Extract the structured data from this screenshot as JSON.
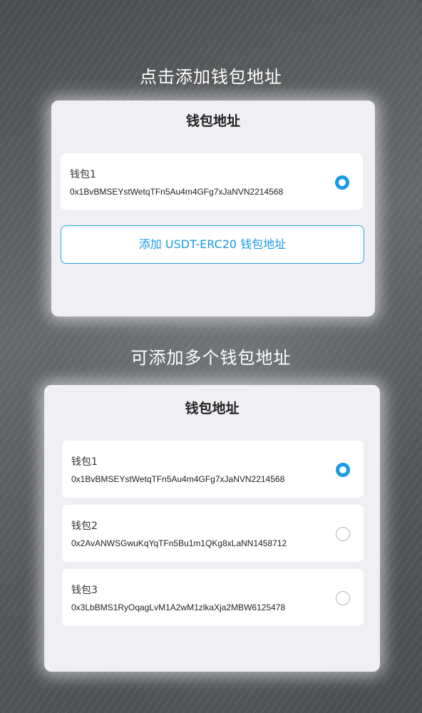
{
  "section1": {
    "heading": "点击添加钱包地址",
    "card_title": "钱包地址",
    "wallets": [
      {
        "name": "钱包1",
        "address": "0x1BvBMSEYstWetqTFn5Au4m4GFg7xJaNVN2214568",
        "selected": true
      }
    ],
    "add_button_label": "添加 USDT-ERC20 钱包地址"
  },
  "section2": {
    "heading": "可添加多个钱包地址",
    "card_title": "钱包地址",
    "wallets": [
      {
        "name": "钱包1",
        "address": "0x1BvBMSEYstWetqTFn5Au4m4GFg7xJaNVN2214568",
        "selected": true
      },
      {
        "name": "钱包2",
        "address": "0x2AvANWSGwuKqYqTFn5Bu1m1QKg8xLaNN1458712",
        "selected": false
      },
      {
        "name": "钱包3",
        "address": "0x3LbBMS1RyOqagLvM1A2wM1zlkaXja2MBW6125478",
        "selected": false
      }
    ]
  },
  "colors": {
    "accent": "#1a9be6",
    "card_bg": "#f0f0f4"
  }
}
